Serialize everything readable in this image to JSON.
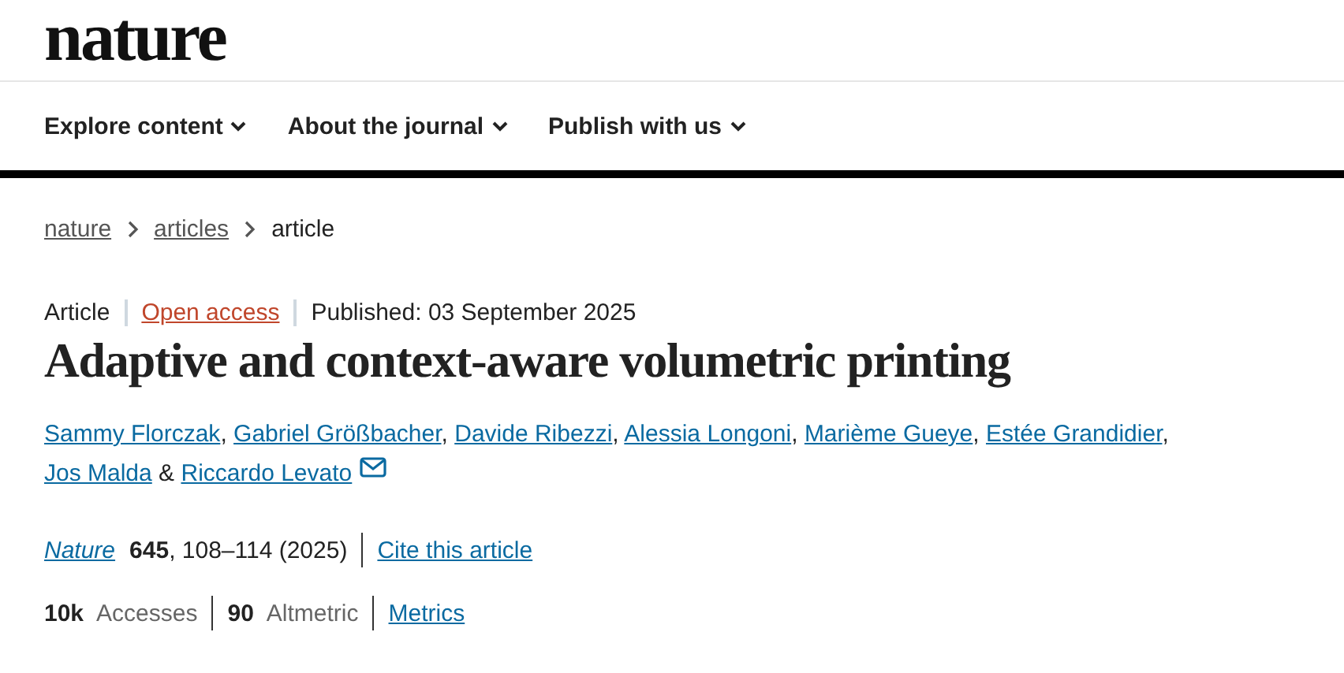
{
  "logo": "nature",
  "nav": [
    {
      "label": "Explore content"
    },
    {
      "label": "About the journal"
    },
    {
      "label": "Publish with us"
    }
  ],
  "breadcrumb": [
    {
      "label": "nature",
      "kind": "link"
    },
    {
      "label": "articles",
      "kind": "link"
    },
    {
      "label": "article",
      "kind": "current"
    }
  ],
  "meta": [
    {
      "label": "Article",
      "kind": "text"
    },
    {
      "label": "Open access",
      "kind": "link"
    },
    {
      "label": "Published: 03 September 2025",
      "kind": "text"
    }
  ],
  "title": "Adaptive and context-aware volumetric printing",
  "authors": [
    {
      "name": "Sammy Florczak",
      "after": ","
    },
    {
      "name": "Gabriel Größbacher",
      "after": ","
    },
    {
      "name": "Davide Ribezzi",
      "after": ","
    },
    {
      "name": "Alessia Longoni",
      "after": ","
    },
    {
      "name": "Marième Gueye",
      "after": ","
    },
    {
      "name": "Estée Grandidier",
      "after": ","
    },
    {
      "name": "Jos Malda",
      "after": "&"
    },
    {
      "name": "Riccardo Levato",
      "corresponding": true
    }
  ],
  "citation": {
    "journal": "Nature",
    "details": "**645**, 108–114 (2025)",
    "cite_link": "Cite this article"
  },
  "metrics": [
    {
      "count": "10k",
      "name": "Accesses"
    },
    {
      "count": "90",
      "name": "Altmetric"
    }
  ],
  "metrics_link": "Metrics"
}
